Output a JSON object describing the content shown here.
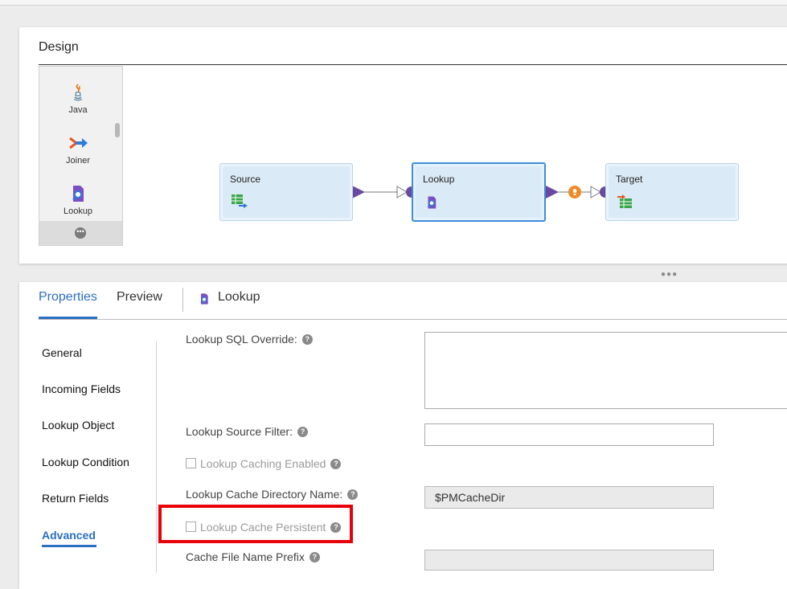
{
  "design": {
    "title": "Design",
    "palette": [
      {
        "label": "Java",
        "icon": "java-icon"
      },
      {
        "label": "Joiner",
        "icon": "joiner-icon"
      },
      {
        "label": "Lookup",
        "icon": "lookup-icon"
      }
    ],
    "more_icon": "more-dots-icon",
    "nodes": {
      "source": {
        "label": "Source",
        "icon": "source-table-icon"
      },
      "lookup": {
        "label": "Lookup",
        "icon": "lookup-icon"
      },
      "target": {
        "label": "Target",
        "icon": "target-table-icon"
      }
    },
    "accent_color": "#6a4aa1",
    "warning_color": "#f08a24"
  },
  "properties": {
    "tabs": {
      "properties": "Properties",
      "preview": "Preview",
      "object": "Lookup"
    },
    "nav": [
      "General",
      "Incoming Fields",
      "Lookup Object",
      "Lookup Condition",
      "Return Fields",
      "Advanced"
    ],
    "active_nav": "Advanced",
    "fields": {
      "sql_override": {
        "label": "Lookup SQL Override:",
        "value": ""
      },
      "source_filter": {
        "label": "Lookup Source Filter:",
        "value": ""
      },
      "caching_enabled": {
        "label": "Lookup Caching Enabled",
        "checked": false
      },
      "cache_directory": {
        "label": "Lookup Cache Directory Name:",
        "value": "$PMCacheDir"
      },
      "cache_persistent": {
        "label": "Lookup Cache Persistent",
        "checked": false
      },
      "cache_prefix": {
        "label": "Cache File Name Prefix",
        "value": ""
      }
    },
    "help_glyph": "?",
    "highlight_color": "#e8000a",
    "link_color": "#2a6fc1"
  }
}
